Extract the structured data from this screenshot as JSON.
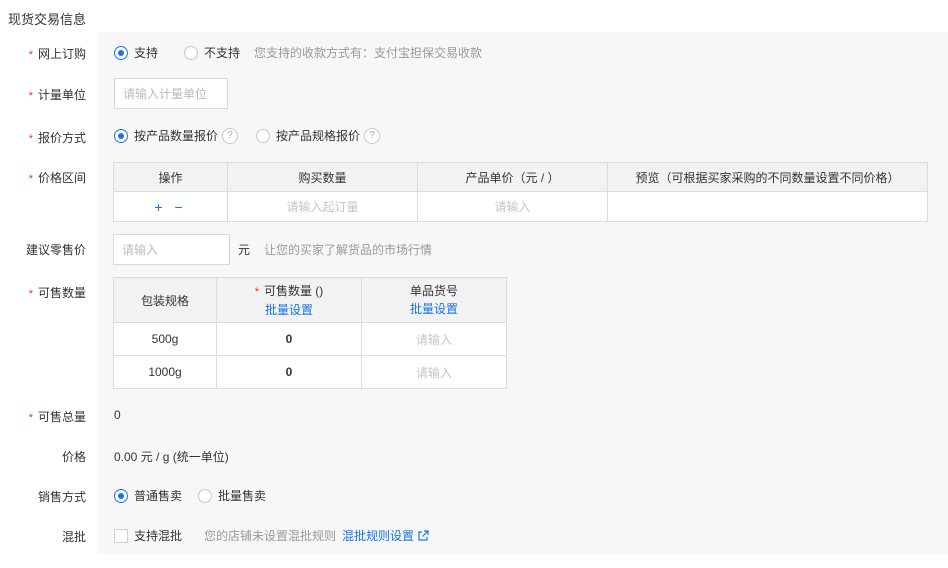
{
  "section_title": "现货交易信息",
  "online_order": {
    "label": "网上订购",
    "option_yes": "支持",
    "option_no": "不支持",
    "hint": "您支持的收款方式有：支付宝担保交易收款"
  },
  "unit": {
    "label": "计量单位",
    "placeholder": "请输入计量单位"
  },
  "pricing_method": {
    "label": "报价方式",
    "option_quantity": "按产品数量报价",
    "option_spec": "按产品规格报价",
    "help_glyph": "?"
  },
  "price_range": {
    "label": "价格区间",
    "headers": [
      "操作",
      "购买数量",
      "产品单价（元 / ）",
      "预览（可根据买家采购的不同数量设置不同价格）"
    ],
    "ops": "+ −",
    "min_qty_placeholder": "请输入起订量",
    "price_placeholder": "请输入"
  },
  "retail_price": {
    "label": "建议零售价",
    "placeholder": "请输入",
    "unit": "元",
    "hint": "让您的买家了解货品的市场行情"
  },
  "stock": {
    "label": "可售数量",
    "headers": {
      "spec": "包装规格",
      "qty": "可售数量 ()",
      "sku": "单品货号",
      "batch_link": "批量设置"
    },
    "rows": [
      {
        "spec": "500g",
        "qty": "0",
        "sku_placeholder": "请输入"
      },
      {
        "spec": "1000g",
        "qty": "0",
        "sku_placeholder": "请输入"
      }
    ]
  },
  "total": {
    "label": "可售总量",
    "value": "0"
  },
  "price": {
    "label": "价格",
    "value": "0.00 元 / g  (统一单位)"
  },
  "sale_method": {
    "label": "销售方式",
    "option_normal": "普通售卖",
    "option_batch": "批量售卖"
  },
  "mix": {
    "label": "混批",
    "checkbox_label": "支持混批",
    "hint": "您的店铺未设置混批规则",
    "link": "混批规则设置"
  },
  "colors": {
    "accent": "#1a73e8",
    "required": "#ff3300",
    "panel_bg": "#f7f7f7"
  }
}
